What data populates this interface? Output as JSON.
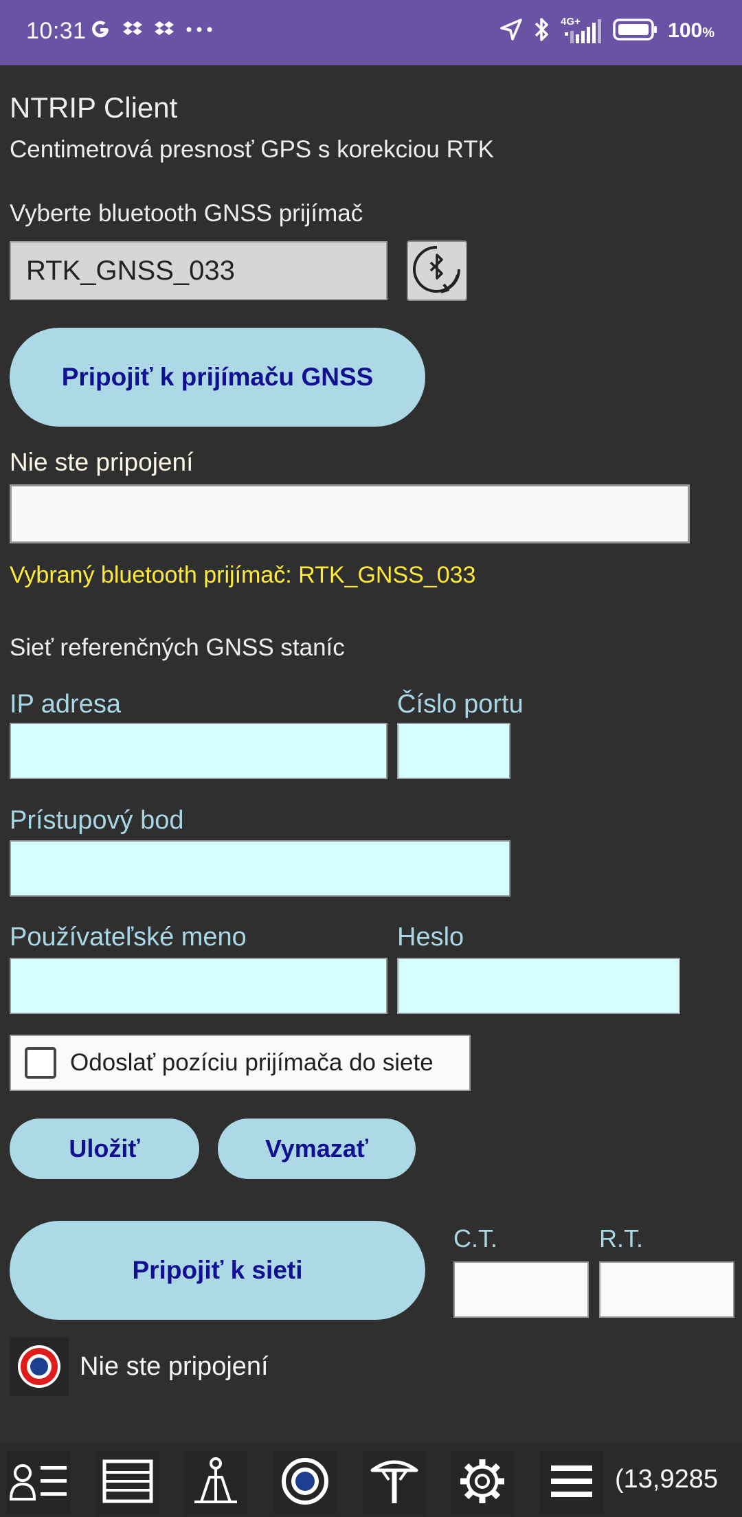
{
  "status_bar": {
    "time": "10:31",
    "battery_percent": "100",
    "battery_unit": "%",
    "network_label": "4G+",
    "icons": [
      "google-icon",
      "dropbox-icon",
      "dropbox-icon",
      "more-dots-icon",
      "location-arrow-icon",
      "bluetooth-icon",
      "signal-icon",
      "battery-icon"
    ]
  },
  "header": {
    "title": "NTRIP Client",
    "subtitle": "Centimetrová presnosť GPS s korekciou RTK"
  },
  "receiver": {
    "select_label": "Vyberte bluetooth GNSS prijímač",
    "selected_device": "RTK_GNSS_033",
    "connect_button": "Pripojiť k prijímaču GNSS",
    "status_label": "Nie ste pripojení",
    "status_value": "",
    "selected_note": "Vybraný bluetooth prijímač: RTK_GNSS_033"
  },
  "network": {
    "section_title": "Sieť referenčných GNSS staníc",
    "ip_label": "IP adresa",
    "ip_value": "",
    "port_label": "Číslo portu",
    "port_value": "",
    "mountpoint_label": "Prístupový bod",
    "mountpoint_value": "",
    "username_label": "Používateľské meno",
    "username_value": "",
    "password_label": "Heslo",
    "password_value": "",
    "send_position_label": "Odoslať pozíciu prijímača do siete",
    "send_position_checked": false,
    "save_button": "Uložiť",
    "clear_button": "Vymazať",
    "connect_button": "Pripojiť k sieti",
    "ct_label": "C.T.",
    "ct_value": "",
    "rt_label": "R.T.",
    "rt_value": "",
    "connection_status": "Nie ste pripojení"
  },
  "bottom_nav": {
    "items": [
      "contacts-list-icon",
      "table-icon",
      "survey-tripod-icon",
      "record-icon",
      "gnss-antenna-icon",
      "settings-gear-icon",
      "menu-icon"
    ],
    "coordinate_text": "(13,9285"
  },
  "colors": {
    "status_bar": "#6a52a5",
    "background": "#2f2f2f",
    "button_fill": "#add8e6",
    "button_text": "#101090",
    "label_blue": "#a9d7e6",
    "note_yellow": "#ffeb3b",
    "input_cyan": "#d5ffff"
  }
}
